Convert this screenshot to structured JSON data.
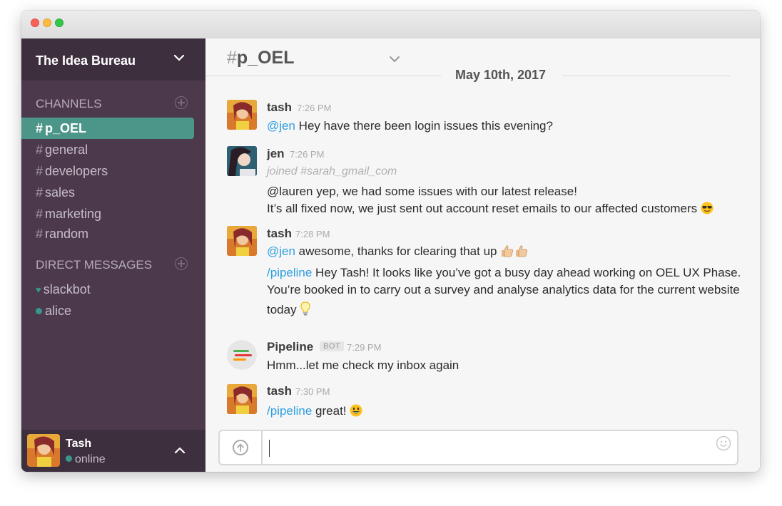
{
  "sidebar": {
    "team_name": "The Idea Bureau",
    "channels_title": "CHANNELS",
    "channels": [
      {
        "hash": "#",
        "name": "p_OEL",
        "active": true
      },
      {
        "hash": "#",
        "name": "general"
      },
      {
        "hash": "#",
        "name": "developers"
      },
      {
        "hash": "#",
        "name": "sales"
      },
      {
        "hash": "#",
        "name": "marketing"
      },
      {
        "hash": "#",
        "name": "random"
      }
    ],
    "dm_title": "DIRECT MESSAGES",
    "dms": [
      {
        "name": "slackbot",
        "icon": "heart-icon"
      },
      {
        "name": "alice",
        "icon": "presence-dot"
      }
    ],
    "user": {
      "name": "Tash",
      "status": "online"
    }
  },
  "channel": {
    "hash": "#",
    "name": "p_OEL",
    "date": "May 10th, 2017"
  },
  "messages": [
    {
      "author": "tash",
      "time": "7:26 PM",
      "lines": [
        {
          "mention": "@jen",
          "text": " Hey have there been login issues this evening?"
        }
      ]
    },
    {
      "author": "jen",
      "time": "7:26 PM",
      "joined": "joined #sarah_gmail_com",
      "lines": [
        {
          "text": "@lauren yep, we had some issues with our latest release!"
        },
        {
          "text": "It’s all fixed now, we just sent out account reset emails to our affected customers"
        }
      ]
    },
    {
      "author": "tash",
      "time": "7:28 PM",
      "lines": [
        {
          "mention": "@jen",
          "text": " awesome, thanks for clearing that up"
        },
        {
          "mention": "/pipeline",
          "text": " Hey Tash! It looks like you’ve got a busy day ahead working on OEL UX Phase."
        },
        {
          "text": "You’re booked in to carry out a survey and analyse analytics data for the current website"
        },
        {
          "text": "today"
        }
      ]
    },
    {
      "author": "Pipeline",
      "badge": "BOT",
      "time": "7:29 PM",
      "lines": [
        {
          "text": "Hmm...let me check my inbox again"
        }
      ]
    },
    {
      "author": "tash",
      "time": "7:30 PM",
      "lines": [
        {
          "mention": "/pipeline",
          "text": " great!"
        }
      ]
    }
  ],
  "colors": {
    "sidebar": "#4c3a4c",
    "active_channel": "#4c9689",
    "mention": "#2d9ee0",
    "presence": "#38978d"
  }
}
